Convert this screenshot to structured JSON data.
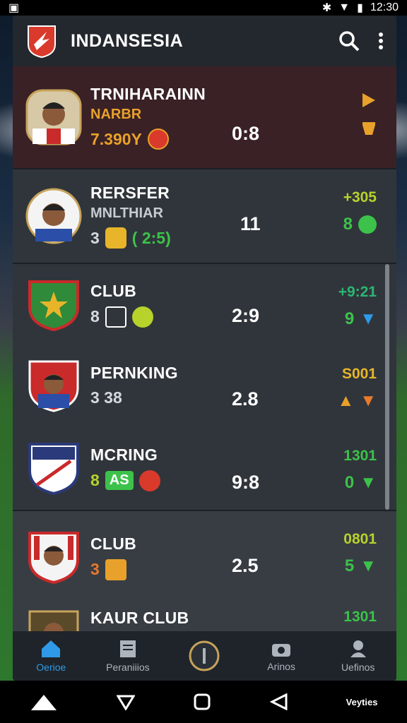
{
  "status": {
    "time": "12:30"
  },
  "app": {
    "title": "INDANSESIA"
  },
  "rows": [
    {
      "name": "TRNIHARAINN",
      "sub": "NARBR",
      "stat": "7.390Y",
      "score": "0:8",
      "right_val": "",
      "right_color": "#e8a12a"
    },
    {
      "name": "RERSFER",
      "sub": "MNLTHIAR",
      "stat": "3",
      "stat_extra": "( 2:5)",
      "score": "11",
      "right_val": "+305",
      "right_color": "#b6d22b"
    },
    {
      "name": "CLUB",
      "sub": "",
      "stat": "8",
      "score": "2:9",
      "right_val": "+9:21",
      "right_color": "#2bb673"
    },
    {
      "name": "PERNKING",
      "sub": "",
      "stat": "3 38",
      "score": "2.8",
      "right_val": "S001",
      "right_color": "#e8b52a"
    },
    {
      "name": "MCRING",
      "sub": "",
      "stat": "8",
      "stat_badge": "AS",
      "score": "9:8",
      "right_val": "1301",
      "right_val2": "0",
      "right_color": "#3cc24a"
    },
    {
      "name": "CLUB",
      "sub": "",
      "stat": "3",
      "score": "2.5",
      "right_val": "0801",
      "right_val2": "5",
      "right_color": "#b6d22b"
    },
    {
      "name": "KAUR CLUB",
      "sub": "",
      "stat": "",
      "score": "",
      "right_val": "1301",
      "right_color": "#3cc24a"
    }
  ],
  "row_right_vals": {
    "r1": "9",
    "r2": "8"
  },
  "nav": {
    "home": "Oerioe",
    "stats": "Peraniiios",
    "news": "Arinos",
    "profile": "Uefinos"
  },
  "sysnav": {
    "right": "Veyties"
  }
}
